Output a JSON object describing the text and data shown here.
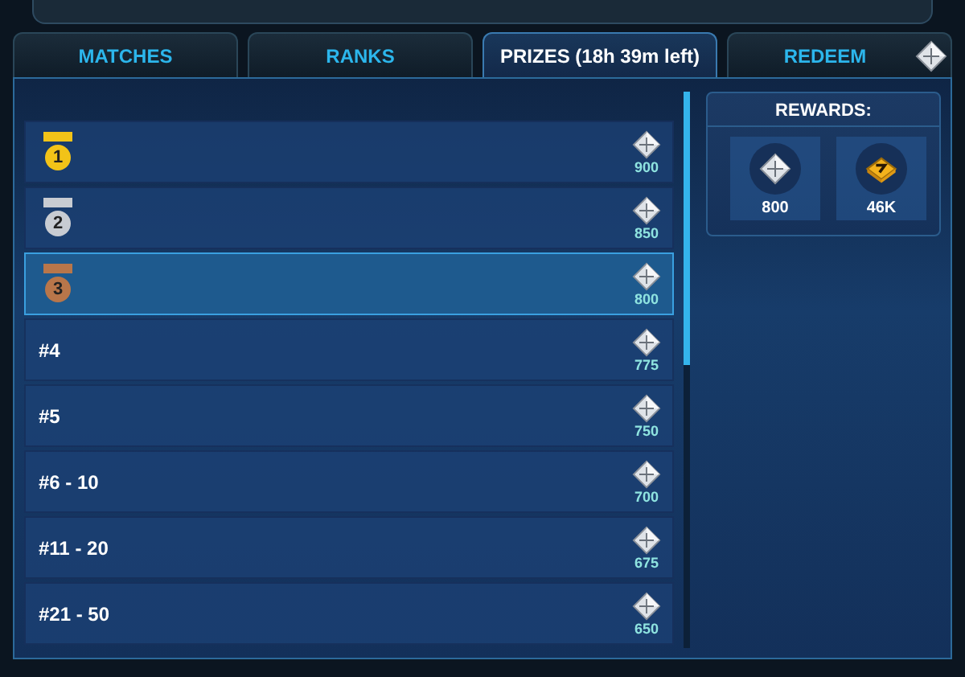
{
  "tabs": [
    {
      "label": "MATCHES",
      "selected": false
    },
    {
      "label": "RANKS",
      "selected": false
    },
    {
      "label": "PRIZES (18h 39m left)",
      "selected": true
    },
    {
      "label": "REDEEM",
      "selected": false
    }
  ],
  "prizes": [
    {
      "kind": "medal",
      "rank": "1",
      "color": "#f2c318",
      "amount": "900",
      "selected": false
    },
    {
      "kind": "medal",
      "rank": "2",
      "color": "#c8ccd2",
      "amount": "850",
      "selected": false
    },
    {
      "kind": "medal",
      "rank": "3",
      "color": "#b8764a",
      "amount": "800",
      "selected": true
    },
    {
      "kind": "text",
      "rank": "#4",
      "amount": "775",
      "selected": false
    },
    {
      "kind": "text",
      "rank": "#5",
      "amount": "750",
      "selected": false
    },
    {
      "kind": "text",
      "rank": "#6 - 10",
      "amount": "700",
      "selected": false
    },
    {
      "kind": "text",
      "rank": "#11 - 20",
      "amount": "675",
      "selected": false
    },
    {
      "kind": "text",
      "rank": "#21 - 50",
      "amount": "650",
      "selected": false
    }
  ],
  "rewards": {
    "title": "REWARDS:",
    "items": [
      {
        "kind": "diamond",
        "amount": "800"
      },
      {
        "kind": "gold",
        "amount": "46K"
      }
    ]
  }
}
